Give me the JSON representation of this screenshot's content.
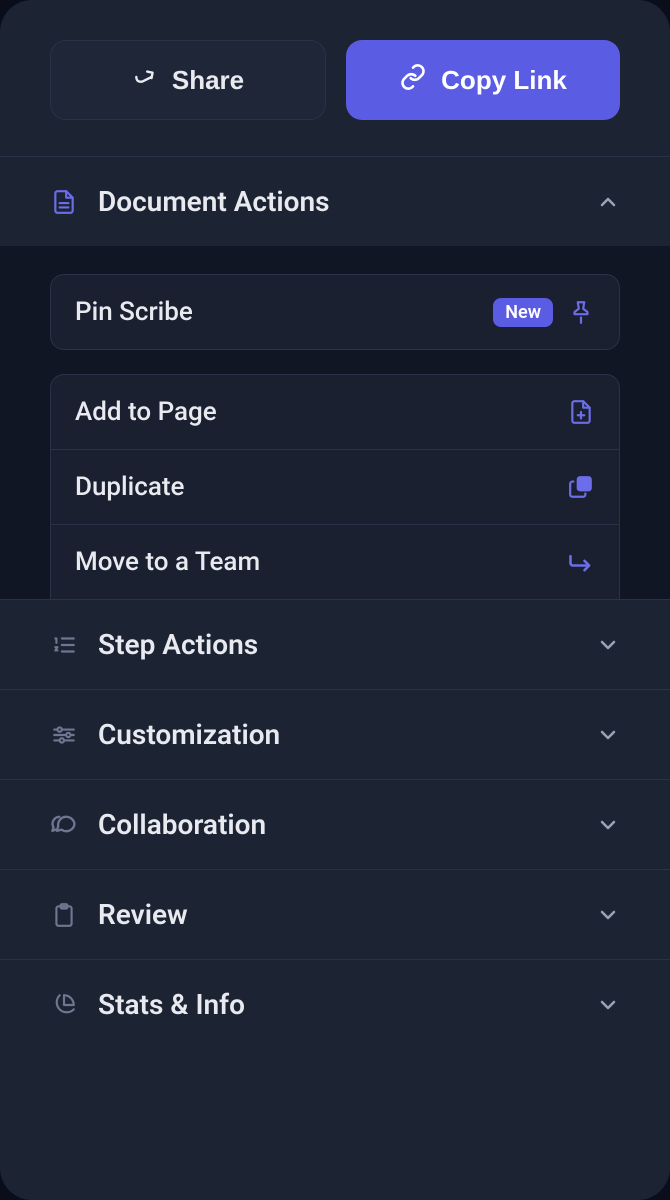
{
  "header": {
    "share_label": "Share",
    "copy_link_label": "Copy Link"
  },
  "sections": {
    "document_actions": {
      "title": "Document Actions",
      "items": {
        "pin_scribe": {
          "label": "Pin Scribe",
          "badge": "New"
        },
        "add_to_page": {
          "label": "Add to Page"
        },
        "duplicate": {
          "label": "Duplicate"
        },
        "move_to_team": {
          "label": "Move to a Team"
        }
      }
    },
    "step_actions": {
      "title": "Step Actions"
    },
    "customization": {
      "title": "Customization"
    },
    "collaboration": {
      "title": "Collaboration"
    },
    "review": {
      "title": "Review"
    },
    "stats_info": {
      "title": "Stats & Info"
    }
  }
}
